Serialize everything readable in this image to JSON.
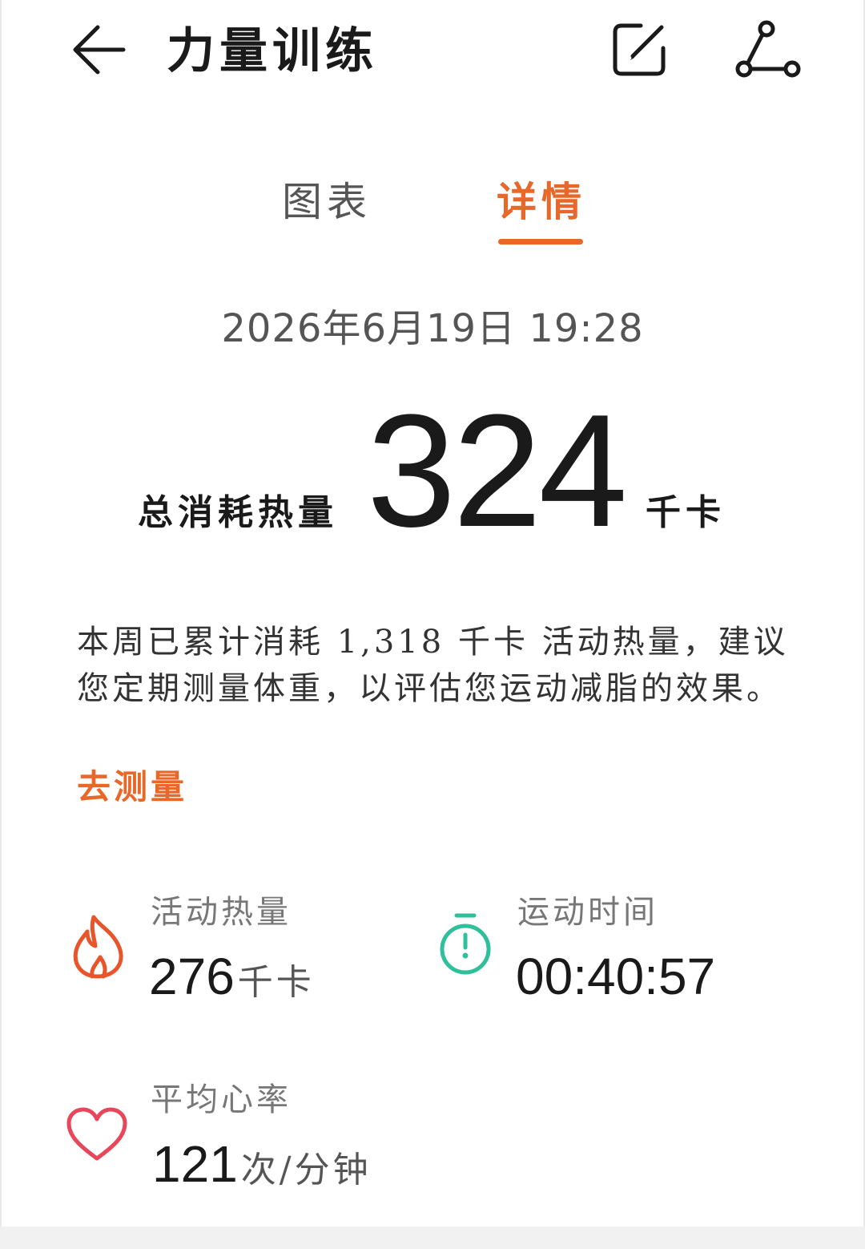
{
  "header": {
    "title": "力量训练"
  },
  "tabs": [
    {
      "label": "图表",
      "active": false
    },
    {
      "label": "详情",
      "active": true
    }
  ],
  "record": {
    "datetime": "2026年6月19日  19:28",
    "total_label": "总消耗热量",
    "total_value": "324",
    "total_unit": "千卡"
  },
  "description": {
    "text": "本周已累计消耗 1,318 千卡 活动热量，建议您定期测量体重，以评估您运动减脂的效果。",
    "link": "去测量"
  },
  "stats": {
    "active_calories": {
      "label": "活动热量",
      "value": "276",
      "unit": "千卡"
    },
    "exercise_time": {
      "label": "运动时间",
      "value": "00:40:57"
    },
    "avg_heart_rate": {
      "label": "平均心率",
      "value": "121",
      "unit": "次/分钟"
    }
  },
  "colors": {
    "accent": "#e8682a",
    "timer_icon": "#2fbf9a",
    "heart_icon": "#e8465a",
    "flame_icon": "#e8552a"
  }
}
